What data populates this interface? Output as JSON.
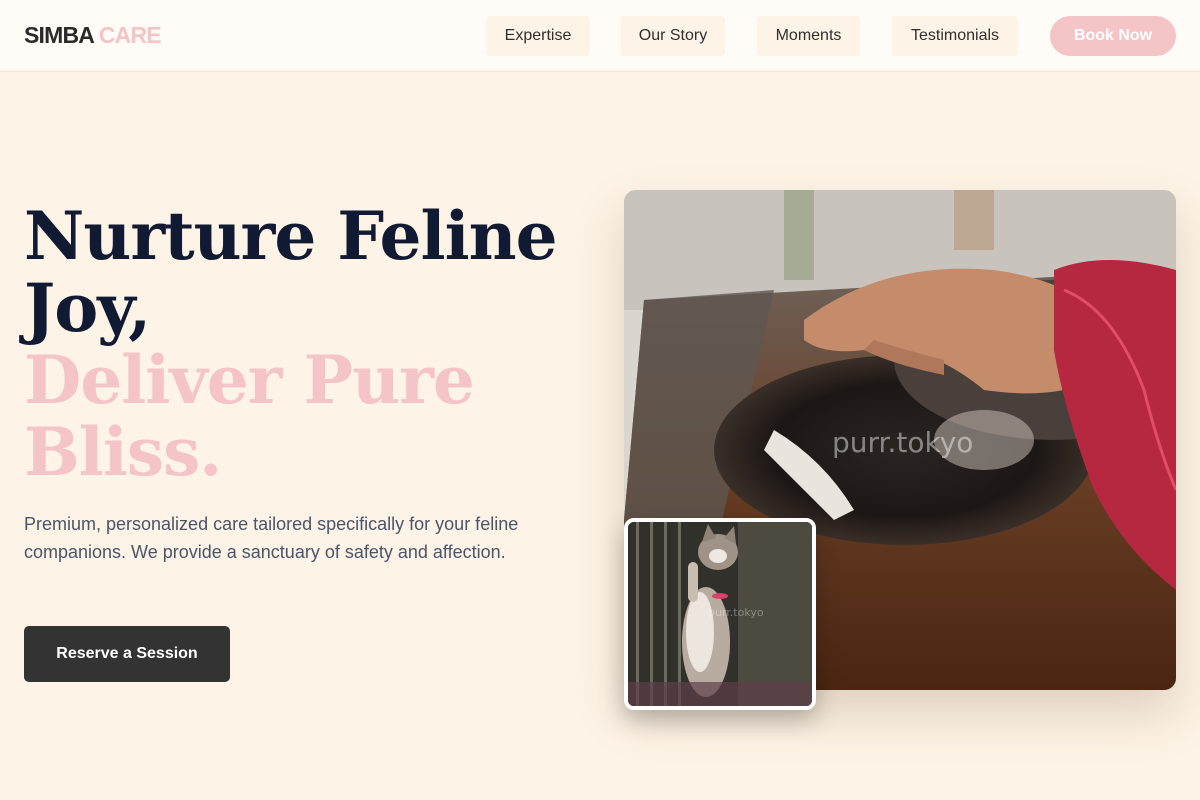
{
  "brand": {
    "name": "SIMBA",
    "accent": "CARE"
  },
  "nav": {
    "items": [
      {
        "label": "Expertise"
      },
      {
        "label": "Our Story"
      },
      {
        "label": "Moments"
      },
      {
        "label": "Testimonials"
      }
    ],
    "book_label": "Book Now"
  },
  "hero": {
    "headline_line1": "Nurture Feline",
    "headline_line2": "Joy,",
    "headline_line3": "Deliver Pure",
    "headline_line4": "Bliss.",
    "tagline": "Premium, personalized care tailored specifically for your feline companions. We provide a sanctuary of safety and affection.",
    "cta_label": "Reserve a Session"
  },
  "images": {
    "main_watermark": "purr.tokyo",
    "inset_watermark": "purr.tokyo"
  },
  "colors": {
    "background": "#fdf3e6",
    "accent_pink": "#f4c4c6",
    "headline_dark": "#111a33",
    "cta_dark": "#333333"
  }
}
